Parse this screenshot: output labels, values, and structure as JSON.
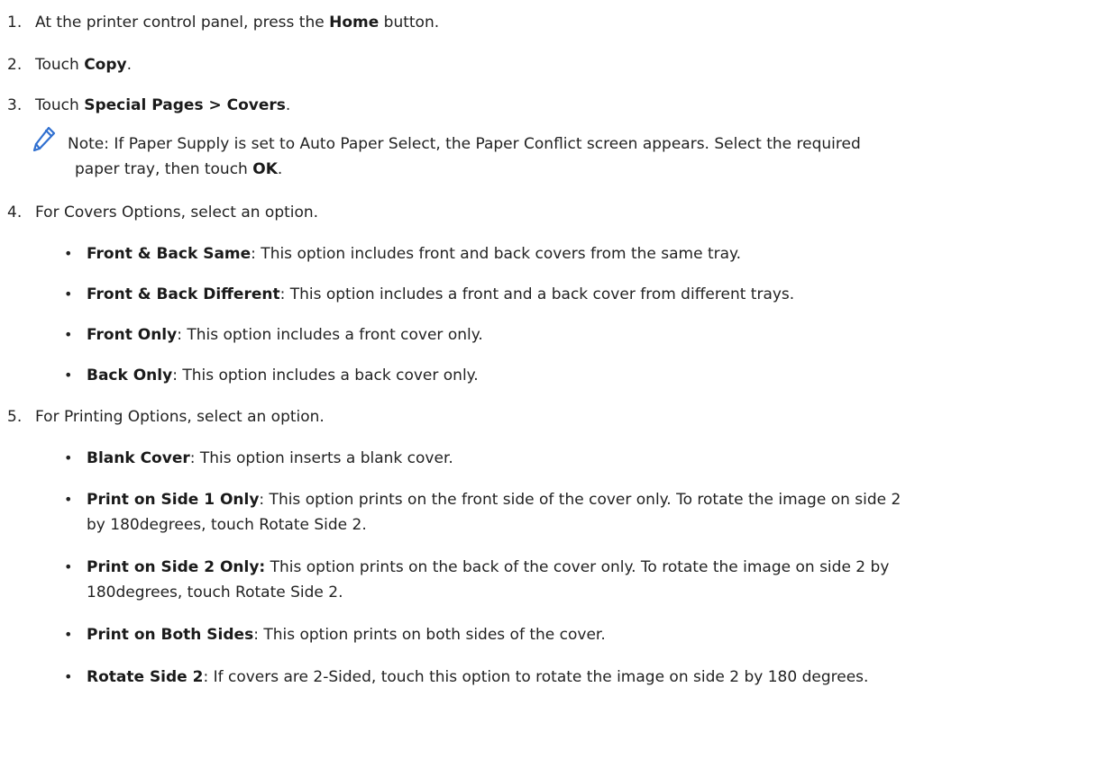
{
  "steps": [
    {
      "num": "1.",
      "pre": "At the printer control panel, press the ",
      "bold": "Home",
      "post": " button."
    },
    {
      "num": "2.",
      "pre": "Touch ",
      "bold": "Copy",
      "post": "."
    },
    {
      "num": "3.",
      "pre": "Touch ",
      "bold": "Special Pages > Covers",
      "post": "."
    },
    {
      "num": "4.",
      "text": "For Covers Options, select an option."
    },
    {
      "num": "5.",
      "text": "For Printing Options, select an option."
    }
  ],
  "note": {
    "icon": "pencil-icon",
    "line1": "Note: If Paper Supply is set to Auto Paper Select, the Paper Conflict screen appears. Select the required",
    "line2_pre": "paper tray, then touch ",
    "line2_bold": "OK",
    "line2_post": "."
  },
  "covers_options": [
    {
      "label": "Front & Back Same",
      "desc": ": This option includes front and back covers from the same tray."
    },
    {
      "label": "Front & Back Different",
      "desc": ": This option includes a front and a back cover from different trays."
    },
    {
      "label": "Front Only",
      "desc": ": This option includes a front cover only."
    },
    {
      "label": "Back Only",
      "desc": ": This option includes a back cover only."
    }
  ],
  "printing_options": [
    {
      "label": "Blank Cover",
      "desc": ": This option inserts a blank cover."
    },
    {
      "label": "Print on Side 1 Only",
      "desc": ": This option prints on the front side of the cover only. To rotate the image on side 2",
      "cont": "by 180degrees, touch Rotate Side 2."
    },
    {
      "label": "Print on Side 2 Only:",
      "desc": " This option prints on the back of the cover only. To rotate the image on side 2 by",
      "cont": "180degrees, touch Rotate Side 2."
    },
    {
      "label": "Print on Both Sides",
      "desc": ": This option prints on both sides of the cover."
    },
    {
      "label": "Rotate Side 2",
      "desc": ": If covers are 2-Sided, touch this option to rotate the image on side 2 by 180 degrees."
    }
  ],
  "colors": {
    "icon": "#2f6fd0"
  }
}
